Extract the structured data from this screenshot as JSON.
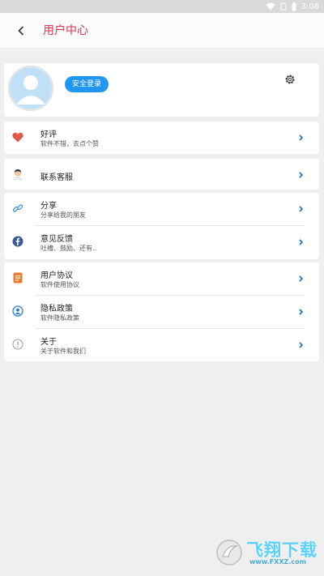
{
  "status_bar": {
    "time": "3:08"
  },
  "header": {
    "title": "用户中心"
  },
  "profile": {
    "login_label": "安全登录"
  },
  "menu": {
    "rating": {
      "title": "好评",
      "subtitle": "软件不错，去点个赞"
    },
    "support": {
      "title": "联系客服"
    },
    "share": {
      "title": "分享",
      "subtitle": "分享给我的朋友"
    },
    "feedback": {
      "title": "意见反馈",
      "subtitle": "吐槽、鼓励、还有.."
    },
    "agreement": {
      "title": "用户协议",
      "subtitle": "软件使用协议"
    },
    "privacy": {
      "title": "隐私政策",
      "subtitle": "软件隐私政策"
    },
    "about": {
      "title": "关于",
      "subtitle": "关于软件和我们"
    }
  },
  "watermark": {
    "brand": "飞翔下载",
    "url": "www.FXXZ.com"
  },
  "colors": {
    "accent": "#e0334f",
    "primary": "#2196f3",
    "heart": "#e2574c",
    "facebook": "#3b5998",
    "doc": "#f07b2c"
  }
}
